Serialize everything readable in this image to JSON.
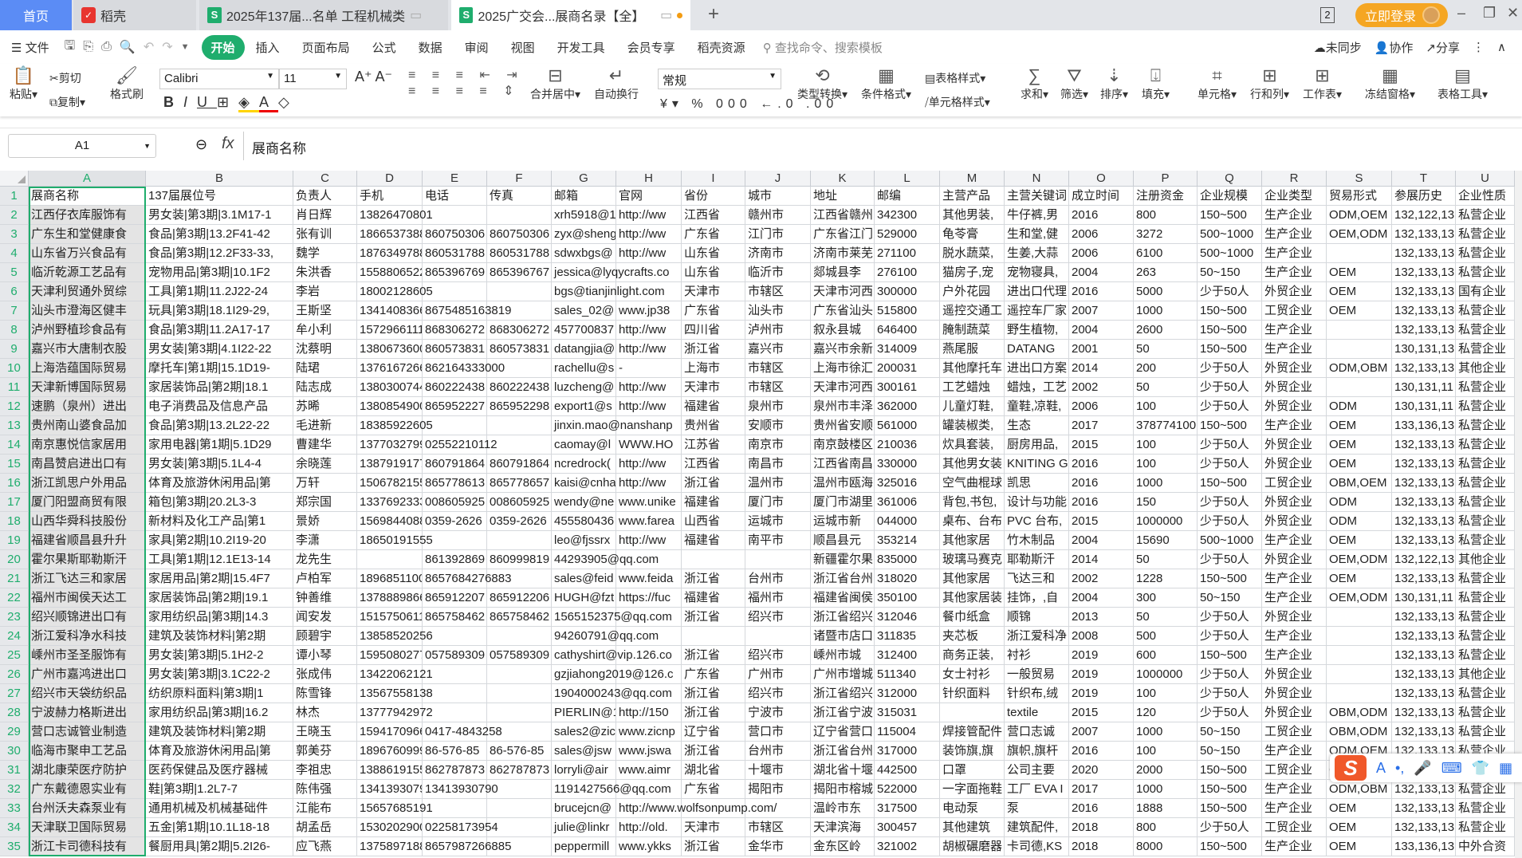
{
  "tabs": {
    "home": "首页",
    "daoke": "稻壳",
    "file1": "2025年137届...名单 工程机械类",
    "file2": "2025广交会...展商名录【全】",
    "window_count": "2",
    "login": "立即登录"
  },
  "menu": {
    "file": "文件",
    "items": [
      "开始",
      "插入",
      "页面布局",
      "公式",
      "数据",
      "审阅",
      "视图",
      "开发工具",
      "会员专享",
      "稻壳资源"
    ],
    "search_placeholder": "查找命令、搜索模板",
    "sync": "未同步",
    "collab": "协作",
    "share": "分享"
  },
  "ribbon": {
    "paste": "粘贴",
    "cut": "剪切",
    "copy": "复制",
    "format_painter": "格式刷",
    "font": "Calibri",
    "size": "11",
    "merge": "合并居中",
    "wrap": "自动换行",
    "number_format": "常规",
    "convert": "类型转换",
    "cond_format": "条件格式",
    "table_style": "表格样式",
    "cell_style": "单元格样式",
    "sum": "求和",
    "filter": "筛选",
    "sort": "排序",
    "fill": "填充",
    "cell": "单元格",
    "rowcol": "行和列",
    "sheet": "工作表",
    "freeze": "冻结窗格",
    "tools": "表格工具"
  },
  "formula_bar": {
    "cell_ref": "A1",
    "fx": "fx",
    "value": "展商名称"
  },
  "sheet": {
    "columns": [
      "A",
      "B",
      "C",
      "D",
      "E",
      "F",
      "G",
      "H",
      "I",
      "J",
      "K",
      "L",
      "M",
      "N",
      "O",
      "P",
      "Q",
      "R",
      "S",
      "T",
      "U"
    ],
    "rows": [
      [
        "展商名称",
        "137届展位号",
        "负责人",
        "手机",
        "电话",
        "传真",
        "邮箱",
        "官网",
        "省份",
        "城市",
        "地址",
        "邮编",
        "主营产品",
        "主营关键词",
        "成立时间",
        "注册资金",
        "企业规模",
        "企业类型",
        "贸易形式",
        "参展历史",
        "企业性质"
      ],
      [
        "江西仔衣库服饰有",
        "男女装|第3期|3.1M17-1",
        "肖日辉",
        "13826470801",
        "",
        "",
        "xrh5918@1",
        "http://ww",
        "江西省",
        "赣州市",
        "江西省赣州",
        "342300",
        "其他男装,",
        "牛仔裤,男",
        "2016",
        "800",
        "150~500",
        "生产企业",
        "ODM,OEM",
        "132,122,13",
        "私营企业"
      ],
      [
        "广东生和堂健康食",
        "食品|第3期|13.2F41-42",
        "张有训",
        "1866537388",
        "860750306",
        "860750306",
        "zyx@sheng",
        "http://ww",
        "广东省",
        "江门市",
        "广东省江门",
        "529000",
        "龟苓膏",
        "生和堂,健",
        "2006",
        "3272",
        "500~1000",
        "生产企业",
        "OEM,ODM",
        "132,133,13",
        "私营企业"
      ],
      [
        "山东省万兴食品有",
        "食品|第3期|12.2F33-33,",
        "魏学",
        "1876349788",
        "860531788",
        "860531788",
        "sdwxbgs@",
        "http://ww",
        "山东省",
        "济南市",
        "济南市莱芜",
        "271100",
        "脱水蔬菜,",
        "生姜,大蒜",
        "2006",
        "6100",
        "500~1000",
        "生产企业",
        "",
        "132,133,13",
        "私营企业"
      ],
      [
        "临沂乾源工艺品有",
        "宠物用品|第3期|10.1F2",
        "朱洪香",
        "1558806522",
        "865396769",
        "865396767",
        "jessica@lyqycrafts.co",
        "",
        "山东省",
        "临沂市",
        "郯城县李",
        "276100",
        "猫房子,宠",
        "宠物寝具,",
        "2004",
        "263",
        "50~150",
        "生产企业",
        "OEM",
        "132,133,13",
        "私营企业"
      ],
      [
        "天津利贸通外贸综",
        "工具|第1期|11.2J22-24",
        "李岩",
        "18002128605",
        "",
        "",
        "bgs@tianjinlight.com",
        "",
        "天津市",
        "市辖区",
        "天津市河西",
        "300000",
        "户外花园",
        "进出口代理",
        "2016",
        "5000",
        "少于50人",
        "外贸企业",
        "OEM",
        "132,133,13",
        "国有企业"
      ],
      [
        "汕头市澄海区健丰",
        "玩具|第3期|18.1I29-29,",
        "王斯坚",
        "1341408366",
        "8675485163819",
        "",
        "sales_02@",
        "www.jp38",
        "广东省",
        "汕头市",
        "广东省汕头",
        "515800",
        "遥控交通工",
        "遥控车厂家",
        "2007",
        "1000",
        "150~500",
        "工贸企业",
        "OEM",
        "132,133,13",
        "私营企业"
      ],
      [
        "泸州野植珍食品有",
        "食品|第3期|11.2A17-17",
        "牟小利",
        "1572966111",
        "868306272",
        "868306272",
        "457700837",
        "http://ww",
        "四川省",
        "泸州市",
        "叙永县城",
        "646400",
        "腌制蔬菜",
        "野生植物,",
        "2004",
        "2600",
        "150~500",
        "生产企业",
        "",
        "132,133,13",
        "私营企业"
      ],
      [
        "嘉兴市大唐制衣股",
        "男女装|第3期|4.1I22-22",
        "沈蔡明",
        "1380673600",
        "860573831",
        "860573831",
        "datangjia@",
        "http://ww",
        "浙江省",
        "嘉兴市",
        "嘉兴市余新",
        "314009",
        "燕尾服",
        "DATANG",
        "2001",
        "50",
        "150~500",
        "生产企业",
        "",
        "130,131,13",
        "私营企业"
      ],
      [
        "上海浩蕴国际贸易",
        "摩托车|第1期|15.1D19-",
        "陆珺",
        "1376167266",
        "862164333000",
        "",
        "rachellu@s",
        "-",
        "上海市",
        "市辖区",
        "上海市徐汇",
        "200031",
        "其他摩托车",
        "进出口方案",
        "2014",
        "200",
        "少于50人",
        "外贸企业",
        "ODM,OBM",
        "132,133,13",
        "其他企业"
      ],
      [
        "天津新博国际贸易",
        "家居装饰品|第2期|18.1",
        "陆志成",
        "1380300744",
        "860222438",
        "860222438",
        "luzcheng@",
        "http://ww",
        "天津市",
        "市辖区",
        "天津市河西",
        "300161",
        "工艺蜡烛",
        "蜡烛，工艺",
        "2002",
        "50",
        "少于50人",
        "外贸企业",
        "",
        "130,131,11",
        "私营企业"
      ],
      [
        "速鹏（泉州）进出",
        "电子消费品及信息产品",
        "苏晞",
        "1380854900",
        "865952227",
        "865952298",
        "export1@s",
        "http://ww",
        "福建省",
        "泉州市",
        "泉州市丰泽",
        "362000",
        "儿童灯鞋,",
        "童鞋,凉鞋,",
        "2006",
        "100",
        "少于50人",
        "外贸企业",
        "ODM",
        "130,131,11",
        "私营企业"
      ],
      [
        "贵州南山婆食品加",
        "食品|第3期|13.2L22-22",
        "毛进新",
        "18385922605",
        "",
        "",
        "jinxin.mao@nanshanp",
        "",
        "贵州省",
        "安顺市",
        "贵州省安顺",
        "561000",
        "罐装椒类,",
        "生态",
        "2017",
        "378774100",
        "150~500",
        "生产企业",
        "OEM",
        "133,136,13",
        "私营企业"
      ],
      [
        "南京惠悦信家居用",
        "家用电器|第1期|5.1D29",
        "曹建华",
        "1377032799",
        "02552210112",
        "",
        "caomay@l",
        "WWW.HO",
        "江苏省",
        "南京市",
        "南京鼓楼区",
        "210036",
        "炊具套装,",
        "厨房用品,",
        "2015",
        "100",
        "少于50人",
        "外贸企业",
        "OEM",
        "132,133,13",
        "私营企业"
      ],
      [
        "南昌赞启进出口有",
        "男女装|第3期|5.1L4-4",
        "余晓莲",
        "1387919177",
        "860791864",
        "860791864",
        "ncredrock(",
        "http://ww",
        "江西省",
        "南昌市",
        "江西省南昌",
        "330000",
        "其他男女装",
        "KNITING G",
        "2016",
        "100",
        "少于50人",
        "外贸企业",
        "OEM",
        "132,133,13",
        "私营企业"
      ],
      [
        "浙江凯思户外用品",
        "体育及旅游休闲用品|第",
        "万轩",
        "1506782155",
        "865778613",
        "865778657",
        "kaisi@cnha",
        "http://ww",
        "浙江省",
        "温州市",
        "温州市瓯海",
        "325016",
        "空气曲棍球",
        "凯思",
        "2016",
        "1000",
        "150~500",
        "工贸企业",
        "OBM,OEM",
        "132,133,13",
        "私营企业"
      ],
      [
        "厦门阳盟商贸有限",
        "箱包|第3期|20.2L3-3",
        "郑宗国",
        "1337692333",
        "008605925",
        "008605925",
        "wendy@ne",
        "www.unike",
        "福建省",
        "厦门市",
        "厦门市湖里",
        "361006",
        "背包,书包,",
        "设计与功能",
        "2016",
        "150",
        "少于50人",
        "外贸企业",
        "ODM",
        "132,133,13",
        "私营企业"
      ],
      [
        "山西华舜科技股份",
        "新材料及化工产品|第1",
        "景娇",
        "1569844088",
        "0359-2626",
        "0359-2626",
        "455580436",
        "www.farea",
        "山西省",
        "运城市",
        "运城市新",
        "044000",
        "桌布、台布",
        "PVC 台布,",
        "2015",
        "1000000",
        "少于50人",
        "外贸企业",
        "ODM",
        "132,133,13",
        "私营企业"
      ],
      [
        "福建省顺昌县升升",
        "家具|第2期|10.2I19-20",
        "李潇",
        "18650191555",
        "",
        "",
        "leo@fjssrx",
        "http://ww",
        "福建省",
        "南平市",
        "顺昌县元",
        "353214",
        "其他家居",
        "竹木制品",
        "2004",
        "15690",
        "500~1000",
        "生产企业",
        "OEM",
        "132,133,13",
        "私营企业"
      ],
      [
        "霍尔果斯耶勒斯汗",
        "工具|第1期|12.1E13-14",
        "龙先生",
        "",
        "861392869",
        "860999819",
        "44293905@qq.com",
        "",
        "",
        "",
        "新疆霍尔果",
        "835000",
        "玻璃马赛克",
        "耶勒斯汗",
        "2014",
        "50",
        "少于50人",
        "外贸企业",
        "OEM,ODM",
        "132,122,13",
        "其他企业"
      ],
      [
        "浙江飞达三和家居",
        "家居用品|第2期|15.4F7",
        "卢柏军",
        "1896851100",
        "8657684276883",
        "",
        "sales@feid",
        "www.feida",
        "浙江省",
        "台州市",
        "浙江省台州",
        "318020",
        "其他家居",
        "飞达三和",
        "2002",
        "1228",
        "150~500",
        "生产企业",
        "OEM",
        "132,133,13",
        "私营企业"
      ],
      [
        "福州市闽侯天达工",
        "家居装饰品|第2期|19.1",
        "钟善维",
        "1378889866",
        "865912207",
        "865912206",
        "HUGH@fzt",
        "https://fuc",
        "福建省",
        "福州市",
        "福建省闽侯",
        "350100",
        "其他家居装",
        "挂饰，,自",
        "2004",
        "300",
        "50~150",
        "生产企业",
        "OEM,ODM",
        "130,131,11",
        "私营企业"
      ],
      [
        "绍兴顺锦进出口有",
        "家用纺织品|第3期|14.3",
        "闻安发",
        "1515750611",
        "865758462",
        "865758462",
        "1565152375@qq.com",
        "",
        "浙江省",
        "绍兴市",
        "浙江省绍兴",
        "312046",
        "餐巾纸盒",
        "顺锦",
        "2013",
        "50",
        "少于50人",
        "外贸企业",
        "",
        "132,133,13",
        "私营企业"
      ],
      [
        "浙江爱科净水科技",
        "建筑及装饰材料|第2期",
        "顾碧宇",
        "13858520256",
        "",
        "",
        "94260791@qq.com",
        "",
        "",
        "",
        "诸暨市店口",
        "311835",
        "夹芯板",
        "浙江爱科净",
        "2008",
        "500",
        "少于50人",
        "生产企业",
        "",
        "132,133,13",
        "私营企业"
      ],
      [
        "嵊州市圣圣服饰有",
        "男女装|第3期|5.1H2-2",
        "谭小琴",
        "1595080277",
        "057589309",
        "057589309",
        "cathyshirt@vip.126.co",
        "",
        "浙江省",
        "绍兴市",
        "嵊州市城",
        "312400",
        "商务正装,",
        "衬衫",
        "2019",
        "600",
        "150~500",
        "生产企业",
        "",
        "132,133,13",
        "私营企业"
      ],
      [
        "广州市嘉鸿进出口",
        "男女装|第3期|3.1C22-2",
        "张成伟",
        "13422062121",
        "",
        "",
        "gzjiahong2019@126.c",
        "",
        "广东省",
        "广州市",
        "广州市增城",
        "511340",
        "女士衬衫",
        "一般贸易",
        "2019",
        "1000000",
        "少于50人",
        "外贸企业",
        "",
        "132,133,13",
        "其他企业"
      ],
      [
        "绍兴市天袋纺织品",
        "纺织原料面料|第3期|1",
        "陈雪锋",
        "13567558138",
        "",
        "",
        "1904000243@qq.com",
        "",
        "浙江省",
        "绍兴市",
        "浙江省绍兴",
        "312000",
        "针织面料",
        "针织布,绒",
        "2019",
        "100",
        "少于50人",
        "外贸企业",
        "",
        "132,133,13",
        "私营企业"
      ],
      [
        "宁波赫力格斯进出",
        "家用纺织品|第3期|16.2",
        "林杰",
        "13777942972",
        "",
        "",
        "PIERLIN@1",
        "http://150",
        "浙江省",
        "宁波市",
        "浙江省宁波",
        "315031",
        "",
        "textile",
        "2015",
        "120",
        "少于50人",
        "外贸企业",
        "OBM,ODM",
        "132,133,13",
        "私营企业"
      ],
      [
        "营口志诚管业制造",
        "建筑及装饰材料|第2期",
        "王晓玉",
        "1594170966",
        "0417-4843258",
        "",
        "sales2@zic",
        "www.zicnp",
        "辽宁省",
        "营口市",
        "辽宁省营口",
        "115004",
        "焊接管配件",
        "营口志诚",
        "2007",
        "1000",
        "50~150",
        "工贸企业",
        "OBM,ODM",
        "132,133,13",
        "私营企业"
      ],
      [
        "临海市聚申工艺品",
        "体育及旅游休闲用品|第",
        "郭美芬",
        "1896760999",
        "86-576-85",
        "86-576-85",
        "sales@jsw",
        "www.jswa",
        "浙江省",
        "台州市",
        "浙江省台州",
        "317000",
        "装饰旗,旗",
        "旗帜,旗杆",
        "2016",
        "100",
        "50~150",
        "生产企业",
        "ODM,OEM",
        "132,133,13",
        "私营企业"
      ],
      [
        "湖北康荣医疗防护",
        "医药保健品及医疗器械",
        "李祖忠",
        "1388619155",
        "862787873",
        "862787873",
        "lorryli@air",
        "www.aimr",
        "湖北省",
        "十堰市",
        "湖北省十堰",
        "442500",
        "口罩",
        "公司主要",
        "2020",
        "2000",
        "150~500",
        "工贸企业",
        "OEM",
        "132,133,13",
        "私营企业"
      ],
      [
        "广东戴德恩实业有",
        "鞋|第3期|1.2L7-7",
        "陈伟强",
        "1341393079",
        "13413930790",
        "",
        "1191427566@qq.com",
        "",
        "广东省",
        "揭阳市",
        "揭阳市榕城",
        "522000",
        "一字面拖鞋",
        "工厂 EVA I",
        "2017",
        "1000",
        "150~500",
        "生产企业",
        "ODM,OBM",
        "132,133,13",
        "私营企业"
      ],
      [
        "台州沃夫森泵业有",
        "通用机械及机械基础件",
        "江能布",
        "15657685191",
        "",
        "",
        "brucejcn@",
        "http://www.wolfsonpump.com/",
        "",
        "",
        "温岭市东",
        "317500",
        "电动泵",
        "泵",
        "2016",
        "1888",
        "150~500",
        "生产企业",
        "OEM",
        "132,133,13",
        "私营企业"
      ],
      [
        "天津联卫国际贸易",
        "五金|第1期|10.1L18-18",
        "胡孟岳",
        "1530202900",
        "02258173954",
        "",
        "julie@linkr",
        "http://old.",
        "天津市",
        "市辖区",
        "天津滨海",
        "300457",
        "其他建筑",
        "建筑配件,",
        "2018",
        "800",
        "少于50人",
        "工贸企业",
        "OEM",
        "132,133,13",
        "私营企业"
      ],
      [
        "浙江卡司德科技有",
        "餐厨用具|第2期|5.2I26-",
        "应飞燕",
        "1375897188",
        "8657987266885",
        "",
        "peppermill",
        "www.ykks",
        "浙江省",
        "金华市",
        "金东区岭",
        "321002",
        "胡椒碾磨器",
        "卡司德,KS",
        "2018",
        "8000",
        "150~500",
        "生产企业",
        "OEM",
        "133,136,13",
        "中外合资"
      ]
    ]
  },
  "ime": {
    "mode": "A",
    "punct": "•,"
  }
}
